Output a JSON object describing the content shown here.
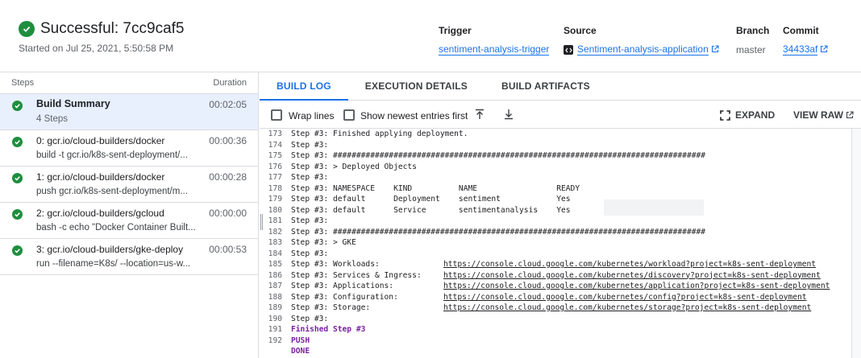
{
  "build": {
    "status_title": "Successful: 7cc9caf5",
    "started": "Started on Jul 25, 2021, 5:50:58 PM"
  },
  "meta": {
    "trigger_label": "Trigger",
    "trigger_value": "sentiment-analysis-trigger",
    "source_label": "Source",
    "source_value": "Sentiment-analysis-application",
    "branch_label": "Branch",
    "branch_value": "master",
    "commit_label": "Commit",
    "commit_value": "34433af"
  },
  "steps": {
    "header_steps": "Steps",
    "header_duration": "Duration",
    "items": [
      {
        "name": "Build Summary",
        "sub": "4 Steps",
        "duration": "00:02:05"
      },
      {
        "name": "0: gcr.io/cloud-builders/docker",
        "sub": "build -t gcr.io/k8s-sent-deployment/...",
        "duration": "00:00:36"
      },
      {
        "name": "1: gcr.io/cloud-builders/docker",
        "sub": "push gcr.io/k8s-sent-deployment/m...",
        "duration": "00:00:28"
      },
      {
        "name": "2: gcr.io/cloud-builders/gcloud",
        "sub": "bash -c echo \"Docker Container Built...",
        "duration": "00:00:00"
      },
      {
        "name": "3: gcr.io/cloud-builders/gke-deploy",
        "sub": "run --filename=K8s/ --location=us-w...",
        "duration": "00:00:53"
      }
    ]
  },
  "tabs": [
    "BUILD LOG",
    "EXECUTION DETAILS",
    "BUILD ARTIFACTS"
  ],
  "toolbar": {
    "wrap": "Wrap lines",
    "newest": "Show newest entries first",
    "expand": "EXPAND",
    "view_raw": "VIEW RAW"
  },
  "log": [
    {
      "n": "173",
      "t": "Step #3: Finished applying deployment."
    },
    {
      "n": "174",
      "t": "Step #3:"
    },
    {
      "n": "175",
      "t": "Step #3: ################################################################################"
    },
    {
      "n": "176",
      "t": "Step #3: > Deployed Objects"
    },
    {
      "n": "177",
      "t": "Step #3:"
    },
    {
      "n": "178",
      "t": "Step #3: NAMESPACE    KIND          NAME                 READY"
    },
    {
      "n": "179",
      "t": "Step #3: default      Deployment    sentiment            Yes"
    },
    {
      "n": "180",
      "t": "Step #3: default      Service       sentimentanalysis    Yes"
    },
    {
      "n": "181",
      "t": "Step #3:"
    },
    {
      "n": "182",
      "t": "Step #3: ################################################################################"
    },
    {
      "n": "183",
      "t": "Step #3: > GKE"
    },
    {
      "n": "184",
      "t": "Step #3:"
    },
    {
      "n": "185",
      "t": "Step #3: Workloads:",
      "u": "https://console.cloud.google.com/kubernetes/workload?project=k8s-sent-deployment"
    },
    {
      "n": "186",
      "t": "Step #3: Services & Ingress:",
      "u": "https://console.cloud.google.com/kubernetes/discovery?project=k8s-sent-deployment"
    },
    {
      "n": "187",
      "t": "Step #3: Applications:",
      "u": "https://console.cloud.google.com/kubernetes/application?project=k8s-sent-deployment"
    },
    {
      "n": "188",
      "t": "Step #3: Configuration:",
      "u": "https://console.cloud.google.com/kubernetes/config?project=k8s-sent-deployment"
    },
    {
      "n": "189",
      "t": "Step #3: Storage:",
      "u": "https://console.cloud.google.com/kubernetes/storage?project=k8s-sent-deployment"
    },
    {
      "n": "190",
      "t": "Step #3:"
    },
    {
      "n": "191",
      "t": "Finished Step #3",
      "s": true
    },
    {
      "n": "192",
      "t": "PUSH",
      "s": true
    },
    {
      "n": "",
      "t": "DONE",
      "s": true
    }
  ]
}
